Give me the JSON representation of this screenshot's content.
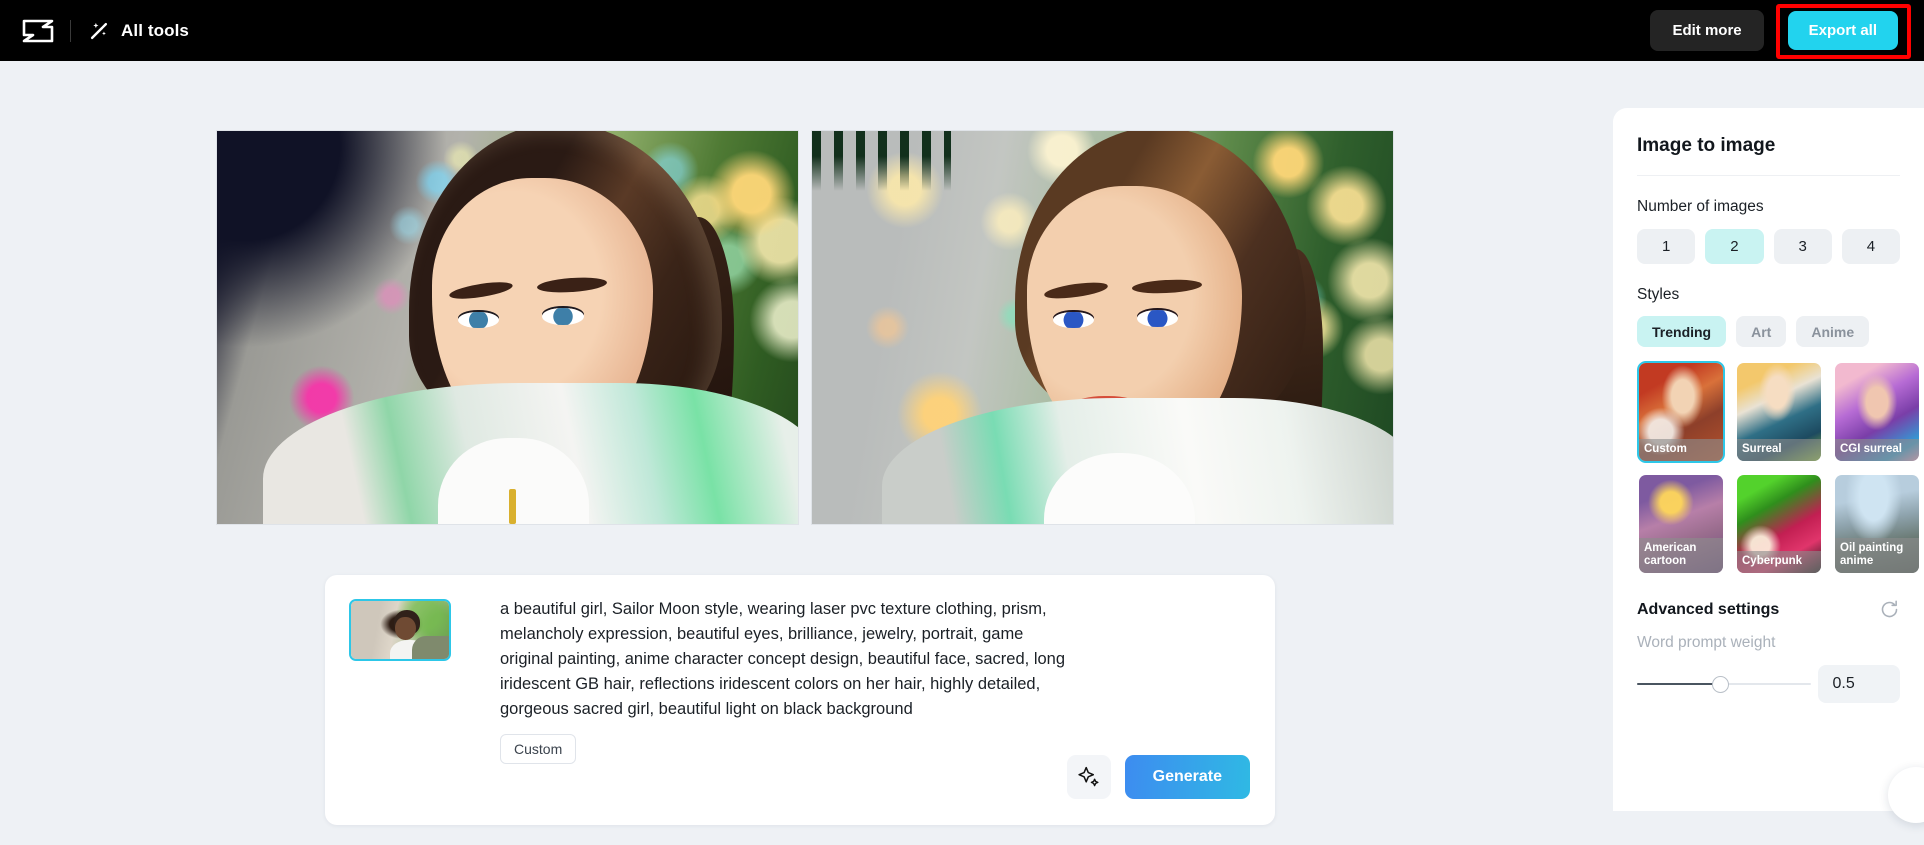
{
  "topbar": {
    "logo_icon": "capcut-logo-icon",
    "alltools_icon": "magic-wand-icon",
    "alltools_label": "All tools",
    "edit_more_label": "Edit more",
    "export_all_label": "Export all",
    "export_highlight_color": "#ff0000",
    "export_button_color": "#22d3ee",
    "background_color": "#000000"
  },
  "canvas": {
    "results": [
      {
        "alt": "generated-image-1",
        "description": "anime style portrait of a woman with dark hair and white jacket on bokeh background"
      },
      {
        "alt": "generated-image-2",
        "description": "anime style portrait of a woman with brown ponytail and white top on green bokeh background"
      }
    ]
  },
  "prompt_card": {
    "reference_thumb_name": "reference-image-thumbnail",
    "prompt_text": "a beautiful girl, Sailor Moon style, wearing laser pvc texture clothing, prism, melancholy expression, beautiful eyes, brilliance, jewelry, portrait, game original painting, anime character concept design, beautiful face, sacred, long iridescent GB hair, reflections iridescent colors on her hair, highly detailed, gorgeous sacred girl, beautiful light on black background",
    "tag_label": "Custom",
    "magic_icon": "sparkle-icon",
    "generate_label": "Generate"
  },
  "sidebar": {
    "title": "Image to image",
    "number_of_images": {
      "label": "Number of images",
      "options": [
        "1",
        "2",
        "3",
        "4"
      ],
      "selected": "2"
    },
    "styles": {
      "label": "Styles",
      "tabs": [
        {
          "label": "Trending",
          "selected": true
        },
        {
          "label": "Art",
          "selected": false
        },
        {
          "label": "Anime",
          "selected": false
        }
      ],
      "items": [
        {
          "label": "Custom",
          "selected": true
        },
        {
          "label": "Surreal",
          "selected": false
        },
        {
          "label": "CGI surreal",
          "selected": false
        },
        {
          "label": "American cartoon",
          "selected": false
        },
        {
          "label": "Cyberpunk",
          "selected": false
        },
        {
          "label": "Oil painting anime",
          "selected": false
        }
      ]
    },
    "advanced": {
      "title": "Advanced settings",
      "reset_icon": "reset-icon",
      "word_prompt_weight_label": "Word prompt weight",
      "word_prompt_weight_value": "0.5",
      "slider_percent": 50
    },
    "accent_color": "#2dc7e8",
    "selected_chip_color": "#c9f3f2"
  }
}
